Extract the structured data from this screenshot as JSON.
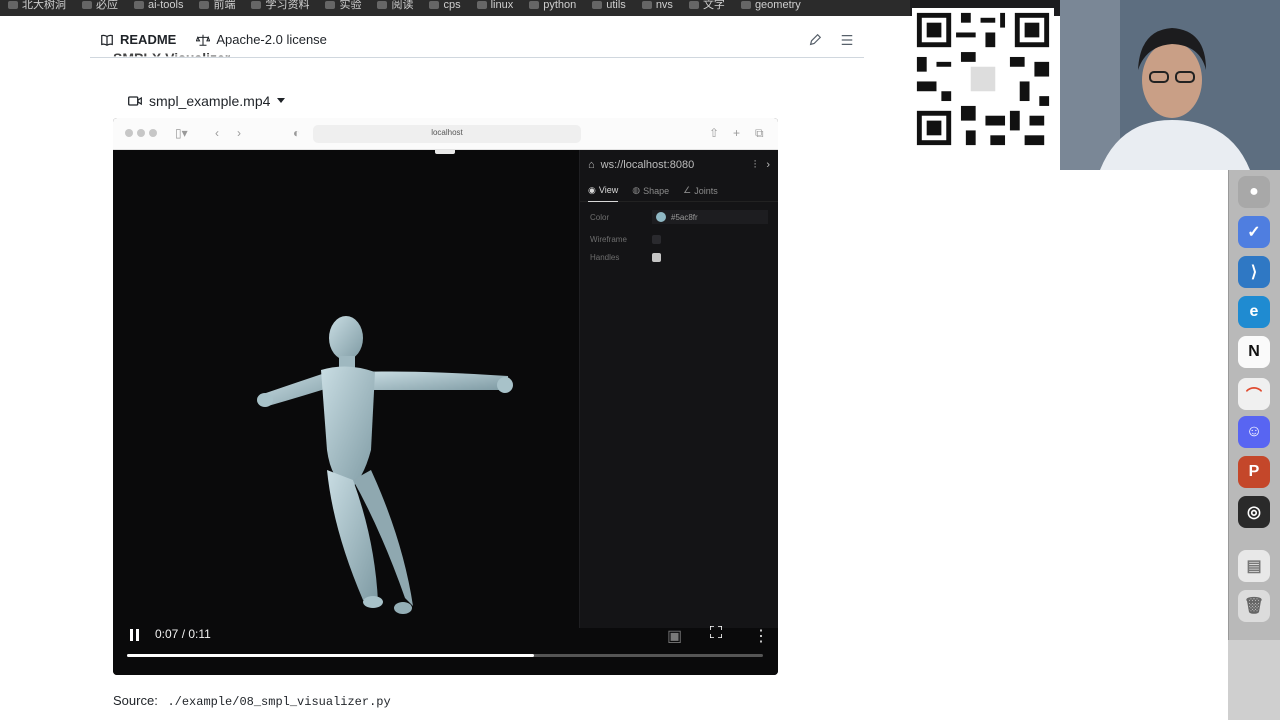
{
  "bookmarks": [
    "北大树洞",
    "必应",
    "ai-tools",
    "前端",
    "学习资料",
    "实验",
    "阅读",
    "cps",
    "linux",
    "python",
    "utils",
    "nvs",
    "文字",
    "geometry"
  ],
  "repo_tabs": {
    "readme": "README",
    "license": "Apache-2.0 license"
  },
  "section_heading": "SMPLX Visualizer",
  "video": {
    "filename": "smpl_example.mp4",
    "url": "localhost",
    "panel": {
      "server": "ws://localhost:8080",
      "tabs": [
        "View",
        "Shape",
        "Joints"
      ],
      "rows": {
        "color_label": "Color",
        "color_value": "#5ac8fr",
        "wireframe_label": "Wireframe",
        "handles_label": "Handles"
      }
    },
    "time_display": "0:07 / 0:11",
    "progress": 0.64
  },
  "source": {
    "label": "Source:",
    "path": "./example/08_smpl_visualizer.py"
  },
  "dock_icons": [
    "wechat-icon",
    "ticktick-icon",
    "vscode-icon",
    "edge-icon",
    "notion-icon",
    "pinduoduo-icon",
    "discord-icon",
    "powerpoint-icon",
    "obs-icon",
    "file-icon",
    "trash-icon"
  ]
}
